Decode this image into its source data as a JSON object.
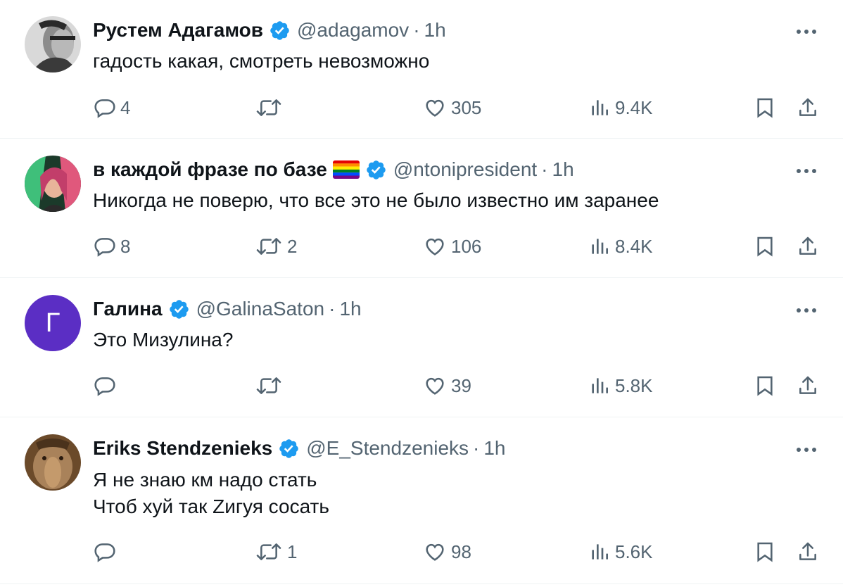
{
  "tweets": [
    {
      "name": "Рустем Адагамов",
      "handle": "@adagamov",
      "time": "1h",
      "text_lines": [
        "гадость какая, смотреть невозможно"
      ],
      "replies": "4",
      "reposts": "",
      "likes": "305",
      "views": "9.4K"
    },
    {
      "name": "в каждой фразе по базе",
      "handle": "@ntonipresident",
      "time": "1h",
      "text_lines": [
        "Никогда не поверю, что все это не было известно им заранее"
      ],
      "replies": "8",
      "reposts": "2",
      "likes": "106",
      "views": "8.4K"
    },
    {
      "name": "Галина",
      "handle": "@GalinaSaton",
      "time": "1h",
      "avatar_letter": "Г",
      "text_lines": [
        "Это Мизулина?"
      ],
      "replies": "",
      "reposts": "",
      "likes": "39",
      "views": "5.8K"
    },
    {
      "name": "Eriks Stendzenieks",
      "handle": "@E_Stendzenieks",
      "time": "1h",
      "text_lines": [
        "Я не знаю км надо стать",
        "Чтоб хуй так Zигуя сосать"
      ],
      "replies": "",
      "reposts": "1",
      "likes": "98",
      "views": "5.6K"
    }
  ],
  "separator": "·",
  "colors": {
    "text": "#0f1419",
    "secondary": "#536471",
    "verified": "#1d9bf0",
    "divider": "#eff3f4",
    "letter_avatar_bg": "#5b2ec4"
  },
  "icons": [
    "reply-icon",
    "repost-icon",
    "like-icon",
    "views-icon",
    "bookmark-icon",
    "share-icon",
    "more-icon",
    "verified-badge-icon",
    "rainbow-flag-icon"
  ]
}
